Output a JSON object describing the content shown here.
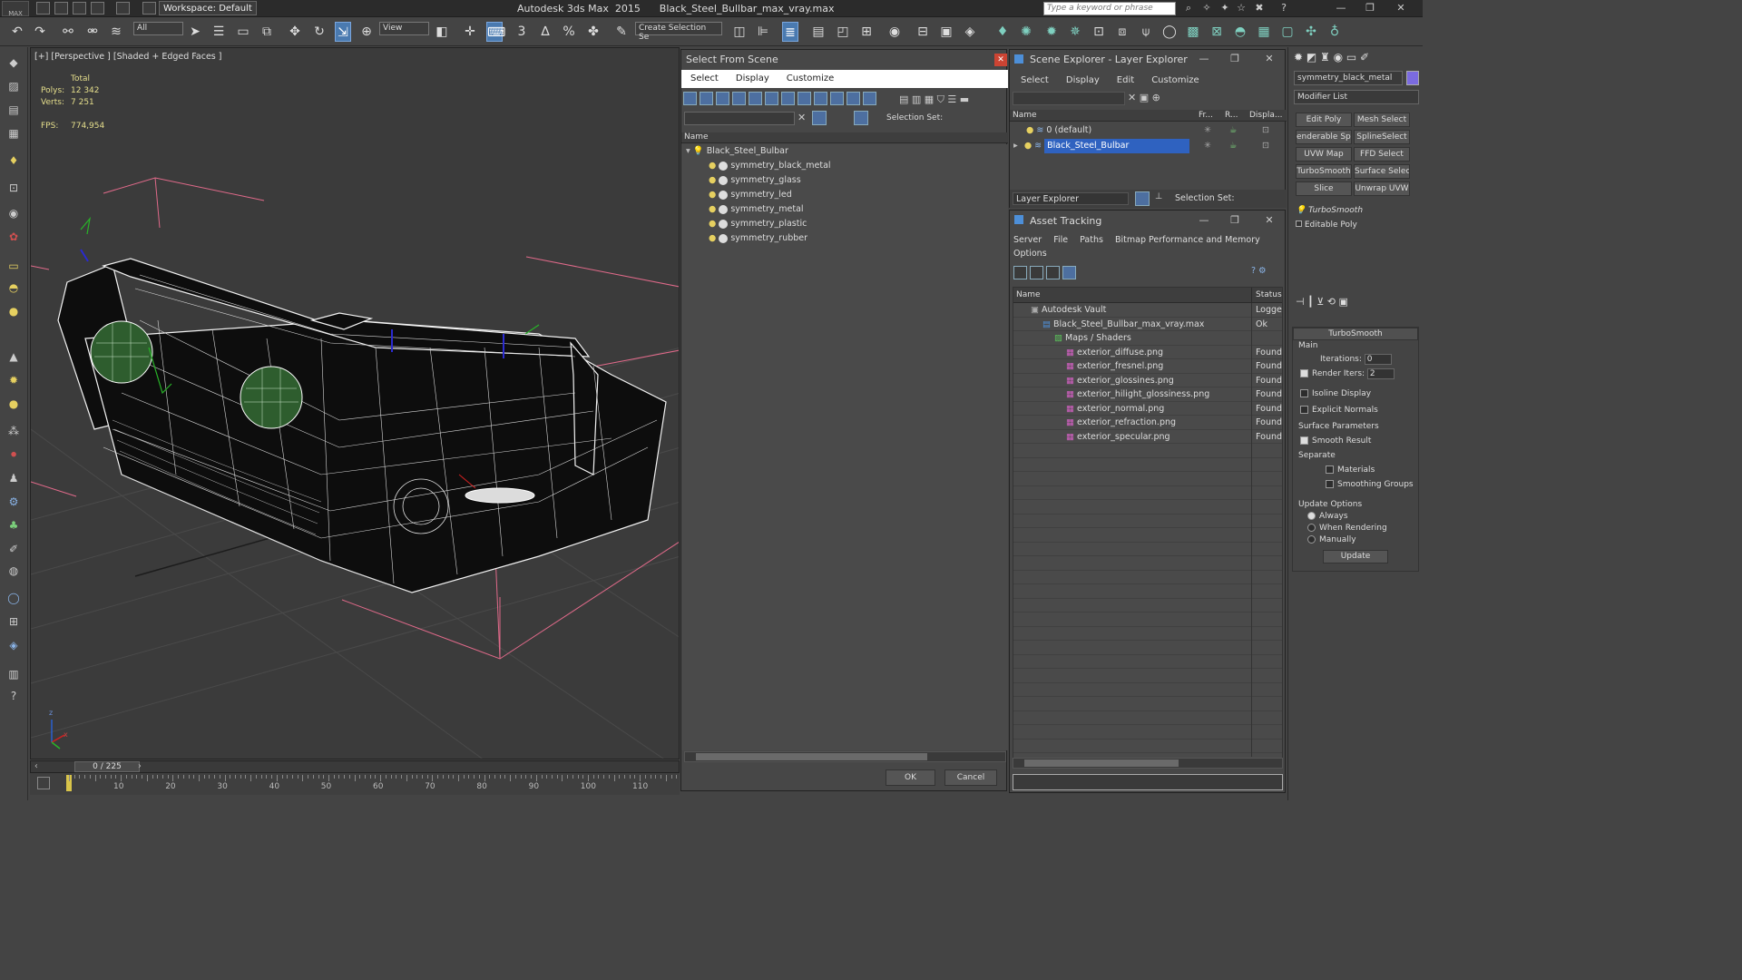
{
  "app": {
    "logo": "MAX",
    "title": "Autodesk 3ds Max  2015      Black_Steel_Bullbar_max_vray.max",
    "workspace": "Workspace: Default",
    "search_placeholder": "Type a keyword or phrase",
    "win_min": "—",
    "win_max": "❐",
    "win_close": "✕",
    "help": "?"
  },
  "toolbar": {
    "filter": "All",
    "refcoord": "View",
    "selection_set": "Create Selection Se",
    "snap": "3",
    "angle": "∆",
    "percent": "%",
    "spinner": "✤"
  },
  "viewport": {
    "label": "[+] [Perspective ] [Shaded + Edged Faces ]",
    "stats_total": "Total",
    "polys_label": "Polys:",
    "polys_value": "12 342",
    "verts_label": "Verts:",
    "verts_value": "7 251",
    "fps_label": "FPS:",
    "fps_value": "774,954",
    "axis_x": "x",
    "axis_z": "z"
  },
  "timeline": {
    "frame": "0 / 225",
    "ticks": [
      "10",
      "20",
      "30",
      "40",
      "50",
      "60",
      "70",
      "80",
      "90",
      "100",
      "110"
    ]
  },
  "select_from_scene": {
    "title": "Select From Scene",
    "menu": [
      "Select",
      "Display",
      "Customize"
    ],
    "selection_set_label": "Selection Set:",
    "col_name": "Name",
    "root": "Black_Steel_Bulbar",
    "items": [
      "symmetry_black_metal",
      "symmetry_glass",
      "symmetry_led",
      "symmetry_metal",
      "symmetry_plastic",
      "symmetry_rubber"
    ],
    "ok": "OK",
    "cancel": "Cancel"
  },
  "scene_explorer": {
    "title": "Scene Explorer - Layer Explorer",
    "menu": [
      "Select",
      "Display",
      "Edit",
      "Customize"
    ],
    "col_name": "Name",
    "col_fr": "Fr...",
    "col_r": "R...",
    "col_disp": "Displa...",
    "layers": [
      "0 (default)",
      "Black_Steel_Bulbar"
    ],
    "footer_combo": "Layer Explorer",
    "selection_set_label": "Selection Set:"
  },
  "asset_tracking": {
    "title": "Asset Tracking",
    "menu": [
      "Server",
      "File",
      "Paths",
      "Bitmap Performance and Memory"
    ],
    "menu2": "Options",
    "col_name": "Name",
    "col_status": "Status",
    "rows": [
      {
        "name": "Autodesk Vault",
        "status": "Logge",
        "indent": 1
      },
      {
        "name": "Black_Steel_Bullbar_max_vray.max",
        "status": "Ok",
        "indent": 2
      },
      {
        "name": "Maps / Shaders",
        "status": "",
        "indent": 3
      },
      {
        "name": "exterior_diffuse.png",
        "status": "Found",
        "indent": 4
      },
      {
        "name": "exterior_fresnel.png",
        "status": "Found",
        "indent": 4
      },
      {
        "name": "exterior_glossines.png",
        "status": "Found",
        "indent": 4
      },
      {
        "name": "exterior_hilight_glossiness.png",
        "status": "Found",
        "indent": 4
      },
      {
        "name": "exterior_normal.png",
        "status": "Found",
        "indent": 4
      },
      {
        "name": "exterior_refraction.png",
        "status": "Found",
        "indent": 4
      },
      {
        "name": "exterior_specular.png",
        "status": "Found",
        "indent": 4
      }
    ]
  },
  "command_panel": {
    "object_name": "symmetry_black_metal",
    "modifier_list": "Modifier List",
    "buttons": [
      "Edit Poly",
      "Mesh Select",
      "enderable Splir",
      "SplineSelect",
      "UVW Map",
      "FFD Select",
      "TurboSmooth",
      "Surface Select",
      "Slice",
      "Unwrap UVW"
    ],
    "stack": [
      "TurboSmooth",
      "Editable Poly"
    ],
    "rollout_title": "TurboSmooth",
    "main": "Main",
    "iterations_label": "Iterations:",
    "iterations_value": "0",
    "render_iters_label": "Render Iters:",
    "render_iters_value": "2",
    "isoline": "Isoline Display",
    "explicit": "Explicit Normals",
    "surface_params": "Surface Parameters",
    "smooth_result": "Smooth Result",
    "separate": "Separate",
    "materials": "Materials",
    "smoothing_groups": "Smoothing Groups",
    "update_options": "Update Options",
    "always": "Always",
    "when_rendering": "When Rendering",
    "manually": "Manually",
    "update": "Update"
  },
  "colors": {
    "accent": "#3d7ad6",
    "selection": "#2f62c0"
  }
}
